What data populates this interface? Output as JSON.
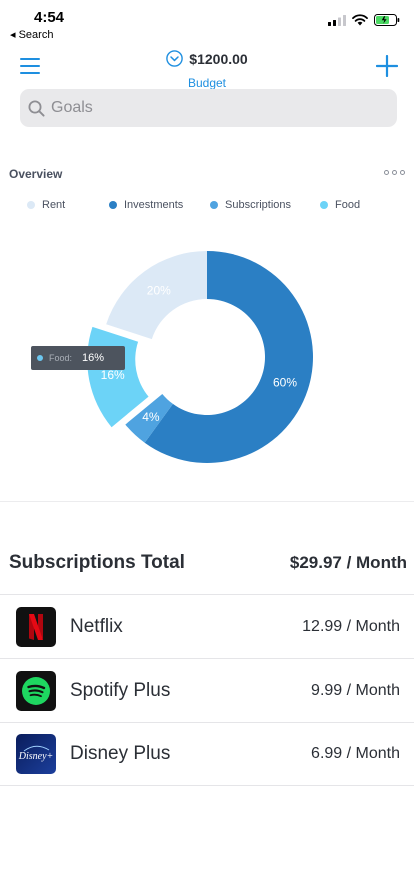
{
  "status_bar": {
    "time": "4:54",
    "back_label": "◂ Search",
    "battery_color": "#4cd964"
  },
  "nav": {
    "budget_amount": "$1200.00",
    "budget_label": "Budget",
    "accent_color": "#1e8fe0"
  },
  "search": {
    "placeholder": "Goals",
    "value": ""
  },
  "overview": {
    "title": "Overview"
  },
  "tooltip": {
    "label": "Food:",
    "value": "16%"
  },
  "chart_data": {
    "type": "pie",
    "variant": "donut",
    "categories": [
      "Rent",
      "Investments",
      "Subscriptions",
      "Food"
    ],
    "values": [
      20,
      60,
      4,
      16
    ],
    "value_labels": [
      "20%",
      "60%",
      "4%",
      "16%"
    ],
    "colors": [
      "#dce9f6",
      "#2b7fc4",
      "#4fa3e0",
      "#6cd3f7"
    ],
    "legend_position": "top",
    "highlighted": "Food"
  },
  "subscriptions": {
    "title": "Subscriptions Total",
    "total": "$29.97 / Month",
    "items": [
      {
        "name": "Netflix",
        "price": "12.99 / Month",
        "icon": "netflix-logo"
      },
      {
        "name": "Spotify Plus",
        "price": "9.99 / Month",
        "icon": "spotify-logo"
      },
      {
        "name": "Disney Plus",
        "price": "6.99 / Month",
        "icon": "disney-plus-logo",
        "icon_text": "Disney+"
      }
    ]
  }
}
